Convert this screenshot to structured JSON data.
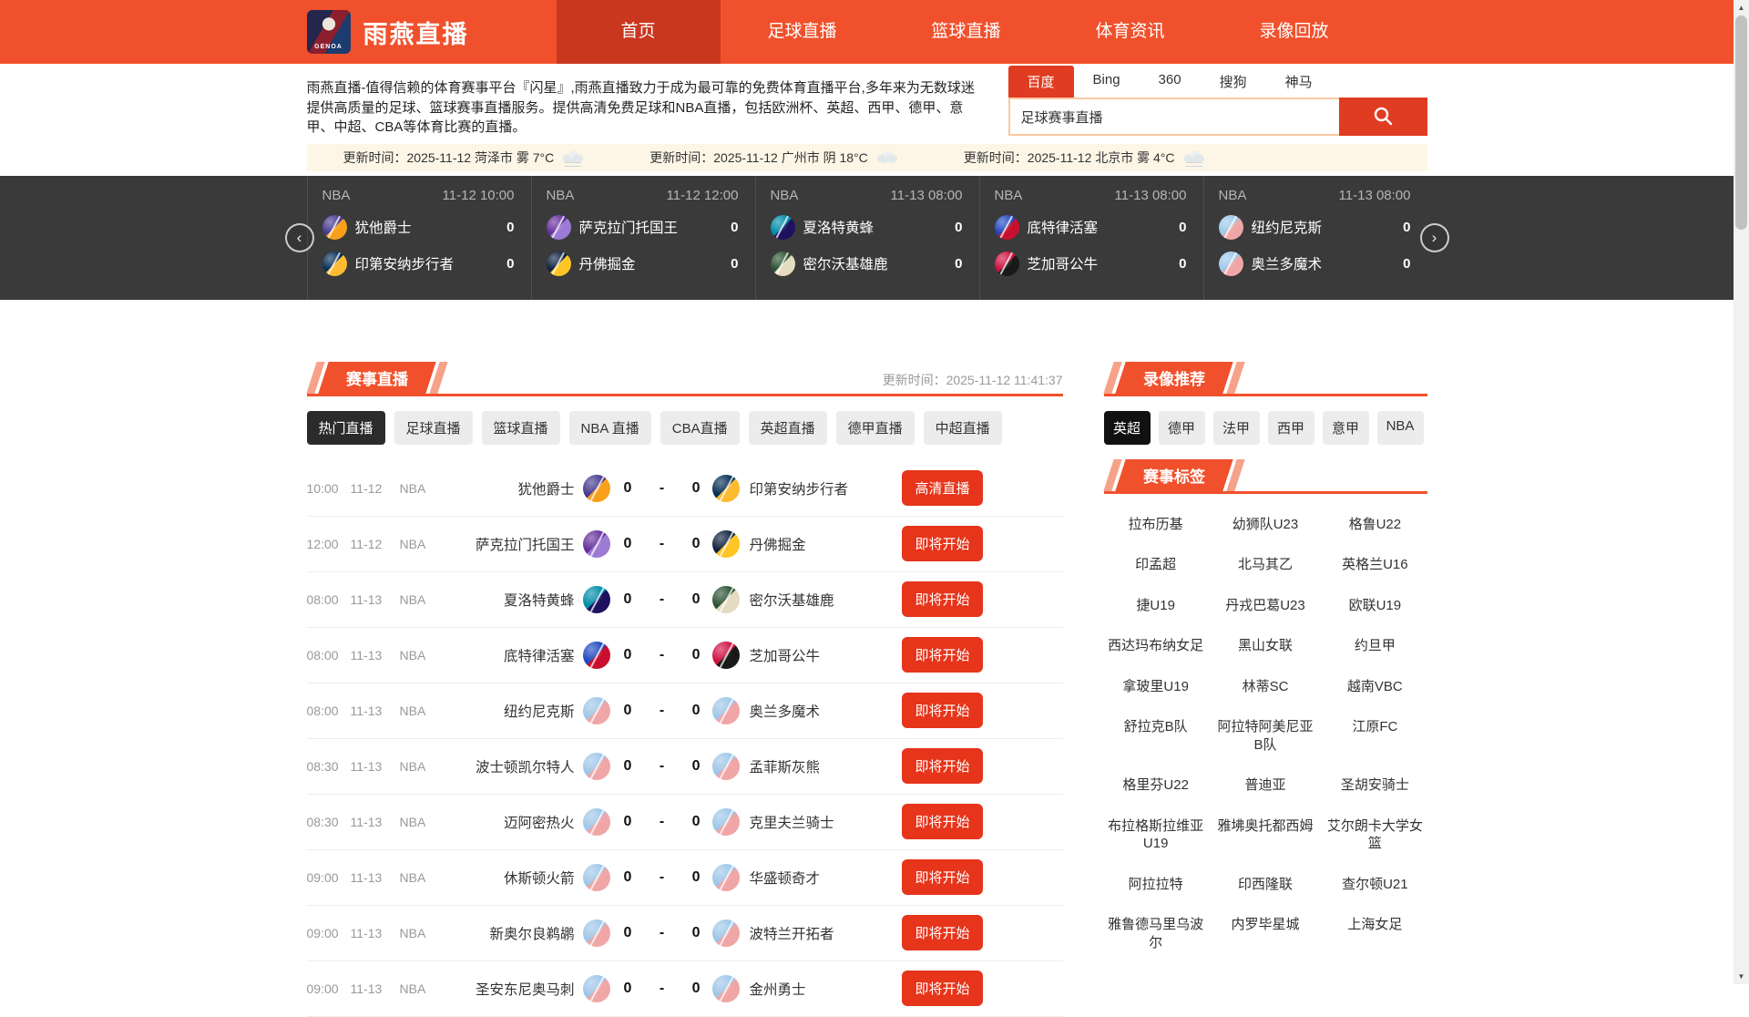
{
  "brand": {
    "title": "雨燕直播",
    "logo_text": "GENOA"
  },
  "nav": {
    "items": [
      {
        "label": "首页",
        "active": true
      },
      {
        "label": "足球直播"
      },
      {
        "label": "篮球直播"
      },
      {
        "label": "体育资讯"
      },
      {
        "label": "录像回放"
      }
    ]
  },
  "intro": {
    "text": "雨燕直播-值得信赖的体育赛事平台『闪星』,雨燕直播致力于成为最可靠的免费体育直播平台,多年来为无数球迷提供高质量的足球、篮球赛事直播服务。提供高清免费足球和NBA直播，包括欧洲杯、英超、西甲、德甲、意甲、中超、CBA等体育比赛的直播。"
  },
  "search": {
    "engines": [
      {
        "label": "百度",
        "active": true
      },
      {
        "label": "Bing"
      },
      {
        "label": "360"
      },
      {
        "label": "搜狗"
      },
      {
        "label": "神马"
      }
    ],
    "query": "足球赛事直播"
  },
  "weather": {
    "items": [
      {
        "text": "更新时间：2025-11-12 菏泽市 雾 7°C",
        "icon": "fog"
      },
      {
        "text": "更新时间：2025-11-12 广州市 阴 18°C",
        "icon": "cloud"
      },
      {
        "text": "更新时间：2025-11-12 北京市 雾 4°C",
        "icon": "fog"
      }
    ]
  },
  "carousel": {
    "cards": [
      {
        "league": "NBA",
        "time": "11-12 10:00",
        "home": {
          "name": "犹他爵士",
          "score": "0",
          "c1": "#473a8f",
          "c2": "#f9a01b"
        },
        "away": {
          "name": "印第安纳步行者",
          "score": "0",
          "c1": "#062f56",
          "c2": "#fdbb30"
        }
      },
      {
        "league": "NBA",
        "time": "11-12 12:00",
        "home": {
          "name": "萨克拉门托国王",
          "score": "0",
          "c1": "#65309c",
          "c2": "#9b7bd3"
        },
        "away": {
          "name": "丹佛掘金",
          "score": "0",
          "c1": "#0e2240",
          "c2": "#fec524"
        }
      },
      {
        "league": "NBA",
        "time": "11-13 08:00",
        "home": {
          "name": "夏洛特黄蜂",
          "score": "0",
          "c1": "#008ca8",
          "c2": "#1d1160"
        },
        "away": {
          "name": "密尔沃基雄鹿",
          "score": "0",
          "c1": "#2c5234",
          "c2": "#e4dcc0"
        }
      },
      {
        "league": "NBA",
        "time": "11-13 08:00",
        "home": {
          "name": "底特律活塞",
          "score": "0",
          "c1": "#2148c0",
          "c2": "#c8102e"
        },
        "away": {
          "name": "芝加哥公牛",
          "score": "0",
          "c1": "#ce1141",
          "c2": "#191919"
        }
      },
      {
        "league": "NBA",
        "time": "11-13 08:00",
        "home": {
          "name": "纽约尼克斯",
          "score": "0",
          "c1": "#9ec7e8",
          "c2": "#f0a6a6"
        },
        "away": {
          "name": "奥兰多魔术",
          "score": "0",
          "c1": "#9ec7e8",
          "c2": "#f0a6a6"
        }
      }
    ]
  },
  "live": {
    "title": "赛事直播",
    "updated": "更新时间：2025-11-12 11:41:37",
    "score_separator": "-",
    "tabs": [
      {
        "label": "热门直播",
        "active": true
      },
      {
        "label": "足球直播"
      },
      {
        "label": "篮球直播"
      },
      {
        "label": "NBA 直播"
      },
      {
        "label": "CBA直播"
      },
      {
        "label": "英超直播"
      },
      {
        "label": "德甲直播"
      },
      {
        "label": "中超直播"
      }
    ],
    "matches": [
      {
        "time": "10:00",
        "date": "11-12",
        "league": "NBA",
        "status": "高清直播",
        "home": {
          "name": "犹他爵士",
          "score": "0",
          "c1": "#473a8f",
          "c2": "#f9a01b"
        },
        "away": {
          "name": "印第安纳步行者",
          "score": "0",
          "c1": "#062f56",
          "c2": "#fdbb30"
        }
      },
      {
        "time": "12:00",
        "date": "11-12",
        "league": "NBA",
        "status": "即将开始",
        "home": {
          "name": "萨克拉门托国王",
          "score": "0",
          "c1": "#65309c",
          "c2": "#9b7bd3"
        },
        "away": {
          "name": "丹佛掘金",
          "score": "0",
          "c1": "#0e2240",
          "c2": "#fec524"
        }
      },
      {
        "time": "08:00",
        "date": "11-13",
        "league": "NBA",
        "status": "即将开始",
        "home": {
          "name": "夏洛特黄蜂",
          "score": "0",
          "c1": "#008ca8",
          "c2": "#1d1160"
        },
        "away": {
          "name": "密尔沃基雄鹿",
          "score": "0",
          "c1": "#2c5234",
          "c2": "#e4dcc0"
        }
      },
      {
        "time": "08:00",
        "date": "11-13",
        "league": "NBA",
        "status": "即将开始",
        "home": {
          "name": "底特律活塞",
          "score": "0",
          "c1": "#2148c0",
          "c2": "#c8102e"
        },
        "away": {
          "name": "芝加哥公牛",
          "score": "0",
          "c1": "#ce1141",
          "c2": "#191919"
        }
      },
      {
        "time": "08:00",
        "date": "11-13",
        "league": "NBA",
        "status": "即将开始",
        "home": {
          "name": "纽约尼克斯",
          "score": "0",
          "c1": "#9ec7e8",
          "c2": "#f0a6a6"
        },
        "away": {
          "name": "奥兰多魔术",
          "score": "0",
          "c1": "#9ec7e8",
          "c2": "#f0a6a6"
        }
      },
      {
        "time": "08:30",
        "date": "11-13",
        "league": "NBA",
        "status": "即将开始",
        "home": {
          "name": "波士顿凯尔特人",
          "score": "0",
          "c1": "#9ec7e8",
          "c2": "#f0a6a6"
        },
        "away": {
          "name": "孟菲斯灰熊",
          "score": "0",
          "c1": "#9ec7e8",
          "c2": "#f0a6a6"
        }
      },
      {
        "time": "08:30",
        "date": "11-13",
        "league": "NBA",
        "status": "即将开始",
        "home": {
          "name": "迈阿密热火",
          "score": "0",
          "c1": "#9ec7e8",
          "c2": "#f0a6a6"
        },
        "away": {
          "name": "克里夫兰骑士",
          "score": "0",
          "c1": "#9ec7e8",
          "c2": "#f0a6a6"
        }
      },
      {
        "time": "09:00",
        "date": "11-13",
        "league": "NBA",
        "status": "即将开始",
        "home": {
          "name": "休斯顿火箭",
          "score": "0",
          "c1": "#9ec7e8",
          "c2": "#f0a6a6"
        },
        "away": {
          "name": "华盛顿奇才",
          "score": "0",
          "c1": "#9ec7e8",
          "c2": "#f0a6a6"
        }
      },
      {
        "time": "09:00",
        "date": "11-13",
        "league": "NBA",
        "status": "即将开始",
        "home": {
          "name": "新奥尔良鹈鹕",
          "score": "0",
          "c1": "#9ec7e8",
          "c2": "#f0a6a6"
        },
        "away": {
          "name": "波特兰开拓者",
          "score": "0",
          "c1": "#9ec7e8",
          "c2": "#f0a6a6"
        }
      },
      {
        "time": "09:00",
        "date": "11-13",
        "league": "NBA",
        "status": "即将开始",
        "home": {
          "name": "圣安东尼奥马刺",
          "score": "0",
          "c1": "#9ec7e8",
          "c2": "#f0a6a6"
        },
        "away": {
          "name": "金州勇士",
          "score": "0",
          "c1": "#9ec7e8",
          "c2": "#f0a6a6"
        }
      }
    ]
  },
  "sidebar": {
    "videos_title": "录像推荐",
    "video_tabs": [
      {
        "label": "英超",
        "active": true
      },
      {
        "label": "德甲"
      },
      {
        "label": "法甲"
      },
      {
        "label": "西甲"
      },
      {
        "label": "意甲"
      },
      {
        "label": "NBA"
      }
    ],
    "tags_title": "赛事标签",
    "tags": [
      "拉布历基",
      "幼狮队U23",
      "格鲁U22",
      "印孟超",
      "北马其乙",
      "英格兰U16",
      "捷U19",
      "丹戎巴葛U23",
      "欧联U19",
      "西达玛布纳女足",
      "黑山女联",
      "约旦甲",
      "拿玻里U19",
      "林蒂SC",
      "越南VBC",
      "舒拉克B队",
      "阿拉特阿美尼亚B队",
      "江原FC",
      "格里芬U22",
      "普迪亚",
      "圣胡安骑士",
      "布拉格斯拉维亚U19",
      "雅坲奥托都西姆",
      "艾尔朗卡大学女篮",
      "阿拉拉特",
      "印西隆联",
      "查尔顿U21",
      "雅鲁德马里乌波尔",
      "内罗毕星城",
      "上海女足"
    ]
  },
  "colors": {
    "accent": "#f0512c",
    "accent_dark": "#c9371f",
    "button_red": "#e6351b",
    "weather_bg": "#fdf6e7",
    "carousel_bg": "#3a3a3a"
  }
}
